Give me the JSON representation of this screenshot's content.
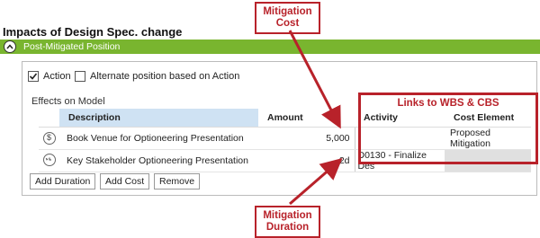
{
  "section": {
    "title": "Impacts of Design Spec. change",
    "bar_label": "Post-Mitigated Position"
  },
  "options": {
    "action_label": "Action",
    "action_checked": true,
    "alternate_label": "Alternate position based on Action",
    "alternate_checked": false
  },
  "effects_label": "Effects on Model",
  "table": {
    "headers": {
      "description": "Description",
      "amount": "Amount",
      "activity": "Activity",
      "cost_element": "Cost Element"
    },
    "rows": [
      {
        "icon": "dollar-icon",
        "description": "Book Venue for Optioneering Presentation",
        "amount": "5,000",
        "activity": "",
        "cost_element": "Proposed Mitigation"
      },
      {
        "icon": "clock-history-icon",
        "description": "Key Stakeholder Optioneering Presentation",
        "amount": "2d",
        "activity": "D0130 - Finalize Des",
        "cost_element": ""
      }
    ]
  },
  "buttons": {
    "add_duration": "Add Duration",
    "add_cost": "Add Cost",
    "remove": "Remove"
  },
  "annotations": {
    "mitigation_cost": [
      "Mitigation",
      "Cost"
    ],
    "links": "Links to WBS & CBS",
    "mitigation_duration": [
      "Mitigation",
      "Duration"
    ],
    "accent_color": "#b8222a"
  },
  "colors": {
    "green_bar": "#79b52f",
    "header_highlight": "#cfe2f3"
  }
}
